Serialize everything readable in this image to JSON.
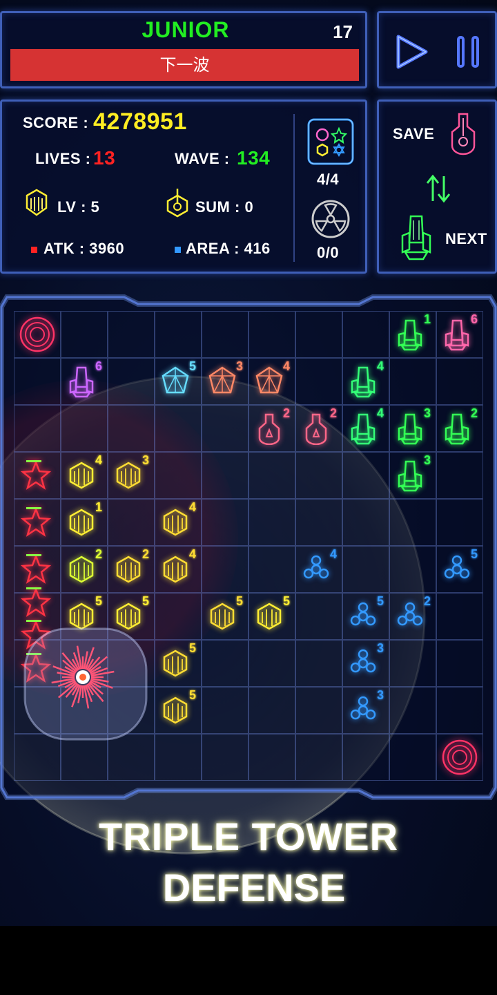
{
  "header": {
    "level_name": "JUNIOR",
    "wave_count": "17",
    "next_wave_label": "下一波"
  },
  "controls": {
    "play_icon": "play-icon",
    "pause_icon": "pause-icon"
  },
  "stats": {
    "score_label": "SCORE :",
    "score_value": "4278951",
    "lives_label": "LIVES :",
    "lives_value": "13",
    "wave_label": "WAVE :",
    "wave_value": "134",
    "lv_label": "LV : 5",
    "sum_label": "SUM : 0",
    "atk_label": "ATK : 3960",
    "area_label": "AREA : 416",
    "slots_value": "4/4",
    "nuke_value": "0/0"
  },
  "save_panel": {
    "save_label": "SAVE",
    "next_label": "NEXT"
  },
  "colors": {
    "level_green": "#22ee22",
    "score_yellow": "#ffee22",
    "lives_red": "#ff2222",
    "wave_green": "#22ee22",
    "next_wave_red": "#d63333",
    "panel_border": "#3f5fb8",
    "atk_marker": "#ff2222",
    "area_marker": "#3399ff"
  },
  "board": {
    "columns": 10,
    "rows": 10,
    "towers": [
      {
        "col": 8,
        "row": 0,
        "level": "1",
        "color": "#33ff55",
        "kind": "ship"
      },
      {
        "col": 9,
        "row": 0,
        "level": "6",
        "color": "#ff66aa",
        "kind": "ship"
      },
      {
        "col": 1,
        "row": 1,
        "level": "6",
        "color": "#cc66ff",
        "kind": "ship"
      },
      {
        "col": 3,
        "row": 1,
        "level": "5",
        "color": "#66ddff",
        "kind": "gem"
      },
      {
        "col": 4,
        "row": 1,
        "level": "3",
        "color": "#ff8866",
        "kind": "gem"
      },
      {
        "col": 5,
        "row": 1,
        "level": "4",
        "color": "#ff8866",
        "kind": "gem"
      },
      {
        "col": 7,
        "row": 1,
        "level": "4",
        "color": "#33ff77",
        "kind": "ship"
      },
      {
        "col": 5,
        "row": 2,
        "level": "2",
        "color": "#ff6688",
        "kind": "bottle"
      },
      {
        "col": 6,
        "row": 2,
        "level": "2",
        "color": "#ff6688",
        "kind": "bottle"
      },
      {
        "col": 7,
        "row": 2,
        "level": "4",
        "color": "#33ff77",
        "kind": "ship"
      },
      {
        "col": 8,
        "row": 2,
        "level": "3",
        "color": "#33ff55",
        "kind": "ship"
      },
      {
        "col": 9,
        "row": 2,
        "level": "2",
        "color": "#33ff55",
        "kind": "ship"
      },
      {
        "col": 1,
        "row": 3,
        "level": "4",
        "color": "#ffee33",
        "kind": "hex"
      },
      {
        "col": 2,
        "row": 3,
        "level": "3",
        "color": "#ffdd33",
        "kind": "hex"
      },
      {
        "col": 8,
        "row": 3,
        "level": "3",
        "color": "#33ff55",
        "kind": "ship"
      },
      {
        "col": 1,
        "row": 4,
        "level": "1",
        "color": "#ffee33",
        "kind": "hex"
      },
      {
        "col": 3,
        "row": 4,
        "level": "4",
        "color": "#ffdd33",
        "kind": "hex"
      },
      {
        "col": 1,
        "row": 5,
        "level": "2",
        "color": "#ddff33",
        "kind": "hex"
      },
      {
        "col": 2,
        "row": 5,
        "level": "2",
        "color": "#ffdd33",
        "kind": "hex"
      },
      {
        "col": 3,
        "row": 5,
        "level": "4",
        "color": "#ffdd33",
        "kind": "hex"
      },
      {
        "col": 6,
        "row": 5,
        "level": "4",
        "color": "#3399ff",
        "kind": "flower"
      },
      {
        "col": 9,
        "row": 5,
        "level": "5",
        "color": "#3399ff",
        "kind": "flower"
      },
      {
        "col": 1,
        "row": 6,
        "level": "5",
        "color": "#ffee33",
        "kind": "hex"
      },
      {
        "col": 2,
        "row": 6,
        "level": "5",
        "color": "#ffee33",
        "kind": "hex"
      },
      {
        "col": 4,
        "row": 6,
        "level": "5",
        "color": "#ffdd33",
        "kind": "hex"
      },
      {
        "col": 5,
        "row": 6,
        "level": "5",
        "color": "#ffee33",
        "kind": "hex"
      },
      {
        "col": 7,
        "row": 6,
        "level": "5",
        "color": "#3399ff",
        "kind": "flower"
      },
      {
        "col": 8,
        "row": 6,
        "level": "2",
        "color": "#3399ff",
        "kind": "flower"
      },
      {
        "col": 3,
        "row": 7,
        "level": "5",
        "color": "#ffdd33",
        "kind": "hex"
      },
      {
        "col": 7,
        "row": 7,
        "level": "3",
        "color": "#3399ff",
        "kind": "flower"
      },
      {
        "col": 3,
        "row": 8,
        "level": "5",
        "color": "#ffdd33",
        "kind": "hex"
      },
      {
        "col": 7,
        "row": 8,
        "level": "3",
        "color": "#3399ff",
        "kind": "flower"
      }
    ],
    "portals": [
      {
        "col": 0,
        "row": 0
      },
      {
        "col": 9,
        "row": 9
      }
    ],
    "enemies": [
      {
        "col": 0,
        "row": 3
      },
      {
        "col": 0,
        "row": 4
      },
      {
        "col": 0,
        "row": 5
      },
      {
        "col": 0,
        "row": 5.7
      },
      {
        "col": 0,
        "row": 6.4
      },
      {
        "col": 0,
        "row": 7.1
      }
    ]
  },
  "tagline": {
    "line1": "TRIPLE TOWER",
    "line2": "DEFENSE"
  }
}
